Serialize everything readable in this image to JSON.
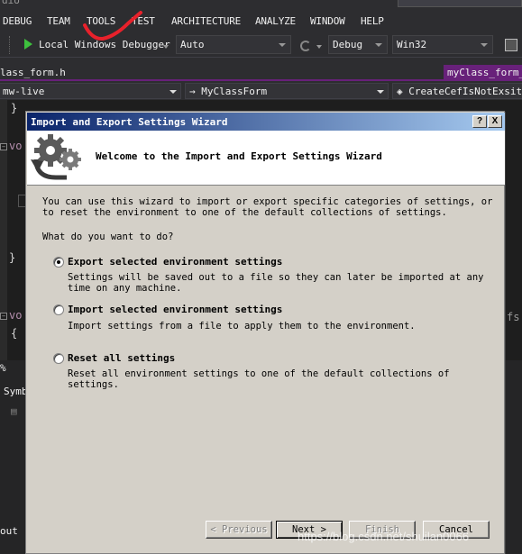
{
  "ide": {
    "title_fragment": "dio",
    "menu": [
      "DEBUG",
      "TEAM",
      "TOOLS",
      "TEST",
      "ARCHITECTURE",
      "ANALYZE",
      "WINDOW",
      "HELP"
    ],
    "toolbar": {
      "run_label": "Local Windows Debugger",
      "platform_target": "Auto",
      "configuration": "Debug",
      "platform": "Win32"
    },
    "tabs": [
      "lass_form.h",
      "myClass_form_u"
    ],
    "nav": {
      "project": "mw-live",
      "class": "MyClassForm",
      "member": "CreateCefIsNotExsit()"
    },
    "code": {
      "brace_close": "}",
      "vo1": "vo",
      "vo2": "vo",
      "brace_open": "{",
      "fragment_right": "fs"
    },
    "bottom": {
      "zoom": "%",
      "symbols_tab": "Symb",
      "output_tab": "out"
    }
  },
  "dialog": {
    "title": "Import and Export Settings Wizard",
    "help_button": "?",
    "close_button": "X",
    "banner_title": "Welcome to the Import and Export Settings Wizard",
    "intro_line1": "You can use this wizard to import or export specific categories of settings, or",
    "intro_line2": "to reset the environment to one of the default collections of settings.",
    "question": "What do you want to do?",
    "options": [
      {
        "title": "Export selected environment settings",
        "desc1": "Settings will be saved out to a file so they can later be imported at any",
        "desc2": "time on any machine.",
        "selected": true
      },
      {
        "title": "Import selected environment settings",
        "desc1": "Import settings from a file to apply them to the environment.",
        "desc2": "",
        "selected": false
      },
      {
        "title": "Reset all settings",
        "desc1": "Reset all environment settings to one of the default collections of",
        "desc2": "settings.",
        "selected": false
      }
    ],
    "buttons": {
      "previous": "< Previous",
      "next": "Next >",
      "finish": "Finish",
      "cancel": "Cancel"
    }
  },
  "watermark": "https://blog.csdn.net/shuilan0066",
  "colors": {
    "ide_bg": "#2d2d30",
    "editor_bg": "#1e1e1e",
    "accent_tab": "#68217a",
    "dialog_bg": "#d4d0c8",
    "title_gradient_start": "#0a246a",
    "annotation_red": "#e8212b"
  }
}
